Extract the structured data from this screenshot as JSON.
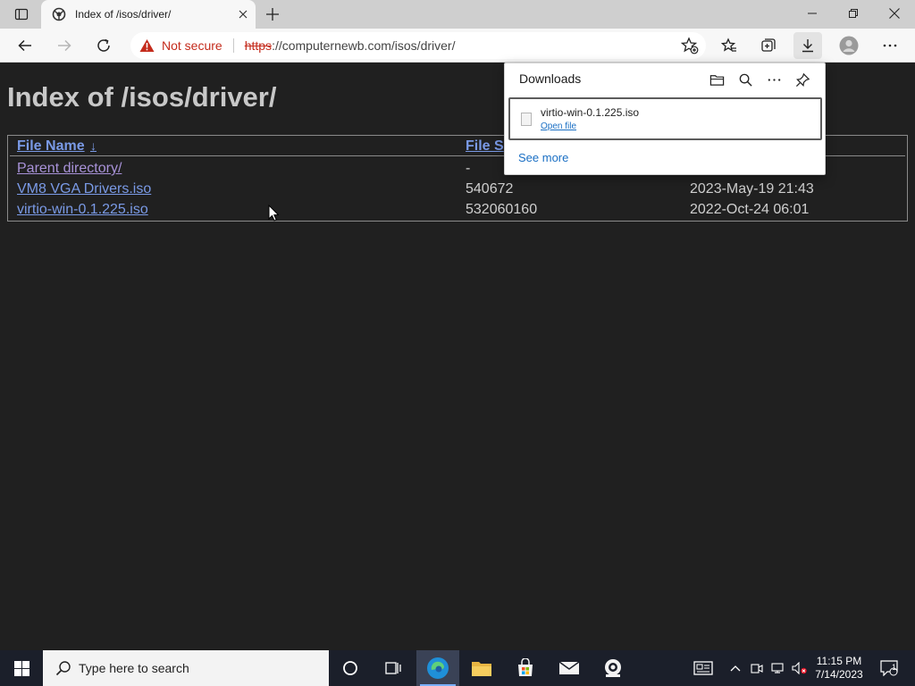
{
  "browser": {
    "tab_title": "Index of /isos/driver/",
    "not_secure_label": "Not secure",
    "url_scheme": "https",
    "url_rest": "://computernewb.com/isos/driver/"
  },
  "page": {
    "title": "Index of /isos/driver/",
    "headers": {
      "name": "File Name",
      "sort_arrow": "↓",
      "size": "File S"
    },
    "rows": [
      {
        "name": "Parent directory/",
        "size": "-",
        "date": ""
      },
      {
        "name": "VM8 VGA Drivers.iso",
        "size": "540672",
        "date": "2023-May-19 21:43"
      },
      {
        "name": "virtio-win-0.1.225.iso",
        "size": "532060160",
        "date": "2022-Oct-24 06:01"
      }
    ]
  },
  "downloads": {
    "title": "Downloads",
    "item": {
      "file_name": "virtio-win-0.1.225.iso",
      "action": "Open file"
    },
    "see_more": "See more"
  },
  "taskbar": {
    "search_placeholder": "Type here to search",
    "time": "11:15 PM",
    "date": "7/14/2023",
    "notification_count": "1"
  },
  "colors": {
    "page_bg": "#202020",
    "link": "#7a9ae6",
    "visited_link": "#a892d8",
    "warning_red": "#c42b1c",
    "taskbar_bg": "#1b1f2a"
  }
}
